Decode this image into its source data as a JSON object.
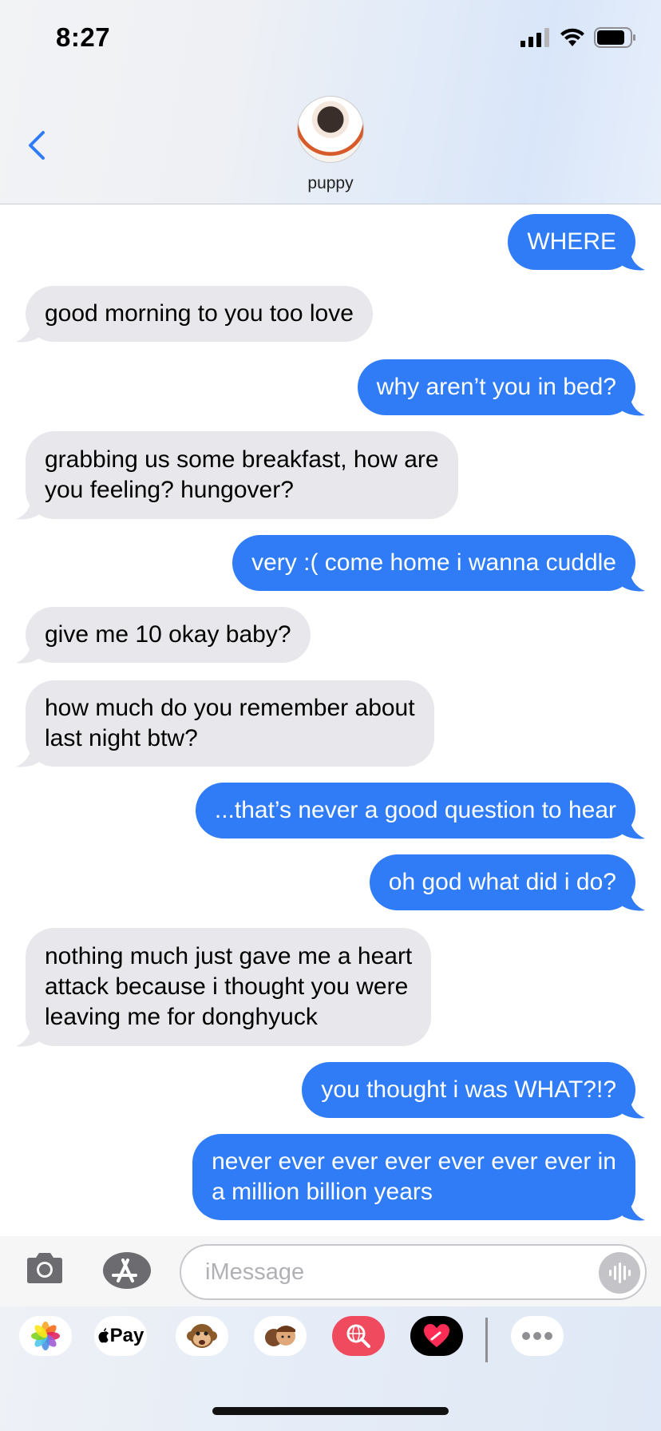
{
  "status": {
    "time": "8:27"
  },
  "contact": {
    "name": "puppy"
  },
  "messages": [
    {
      "dir": "out",
      "text": "WHERE"
    },
    {
      "dir": "in",
      "text": "good morning to you too love"
    },
    {
      "dir": "out",
      "text": "why aren’t you in bed?"
    },
    {
      "dir": "in",
      "text": "grabbing us some breakfast, how are\nyou feeling? hungover?"
    },
    {
      "dir": "out",
      "text": "very :( come home i wanna cuddle"
    },
    {
      "dir": "in",
      "text": "give me 10 okay baby?"
    },
    {
      "dir": "in",
      "text": "how much do you remember about\nlast night btw?"
    },
    {
      "dir": "out",
      "text": "...that’s never a good question to hear"
    },
    {
      "dir": "out",
      "text": "oh god what did i do?"
    },
    {
      "dir": "in",
      "text": "nothing much just gave me a heart\nattack because i thought you were\nleaving me for donghyuck"
    },
    {
      "dir": "out",
      "text": "you thought i was WHAT?!?"
    },
    {
      "dir": "out",
      "text": "never ever ever ever ever ever ever in\na million billion years"
    }
  ],
  "compose": {
    "placeholder": "iMessage"
  },
  "apps": [
    {
      "name": "photos-app-icon",
      "label": ""
    },
    {
      "name": "apple-pay-app-icon",
      "label": "Pay"
    },
    {
      "name": "animoji-app-icon",
      "label": ""
    },
    {
      "name": "memoji-app-icon",
      "label": ""
    },
    {
      "name": "search-images-app-icon",
      "label": ""
    },
    {
      "name": "digital-touch-app-icon",
      "label": ""
    },
    {
      "name": "more-apps-icon",
      "label": ""
    }
  ],
  "colors": {
    "outgoing": "#2f7cf6",
    "incoming": "#e8e8ec",
    "accent": "#2f7cf6"
  }
}
